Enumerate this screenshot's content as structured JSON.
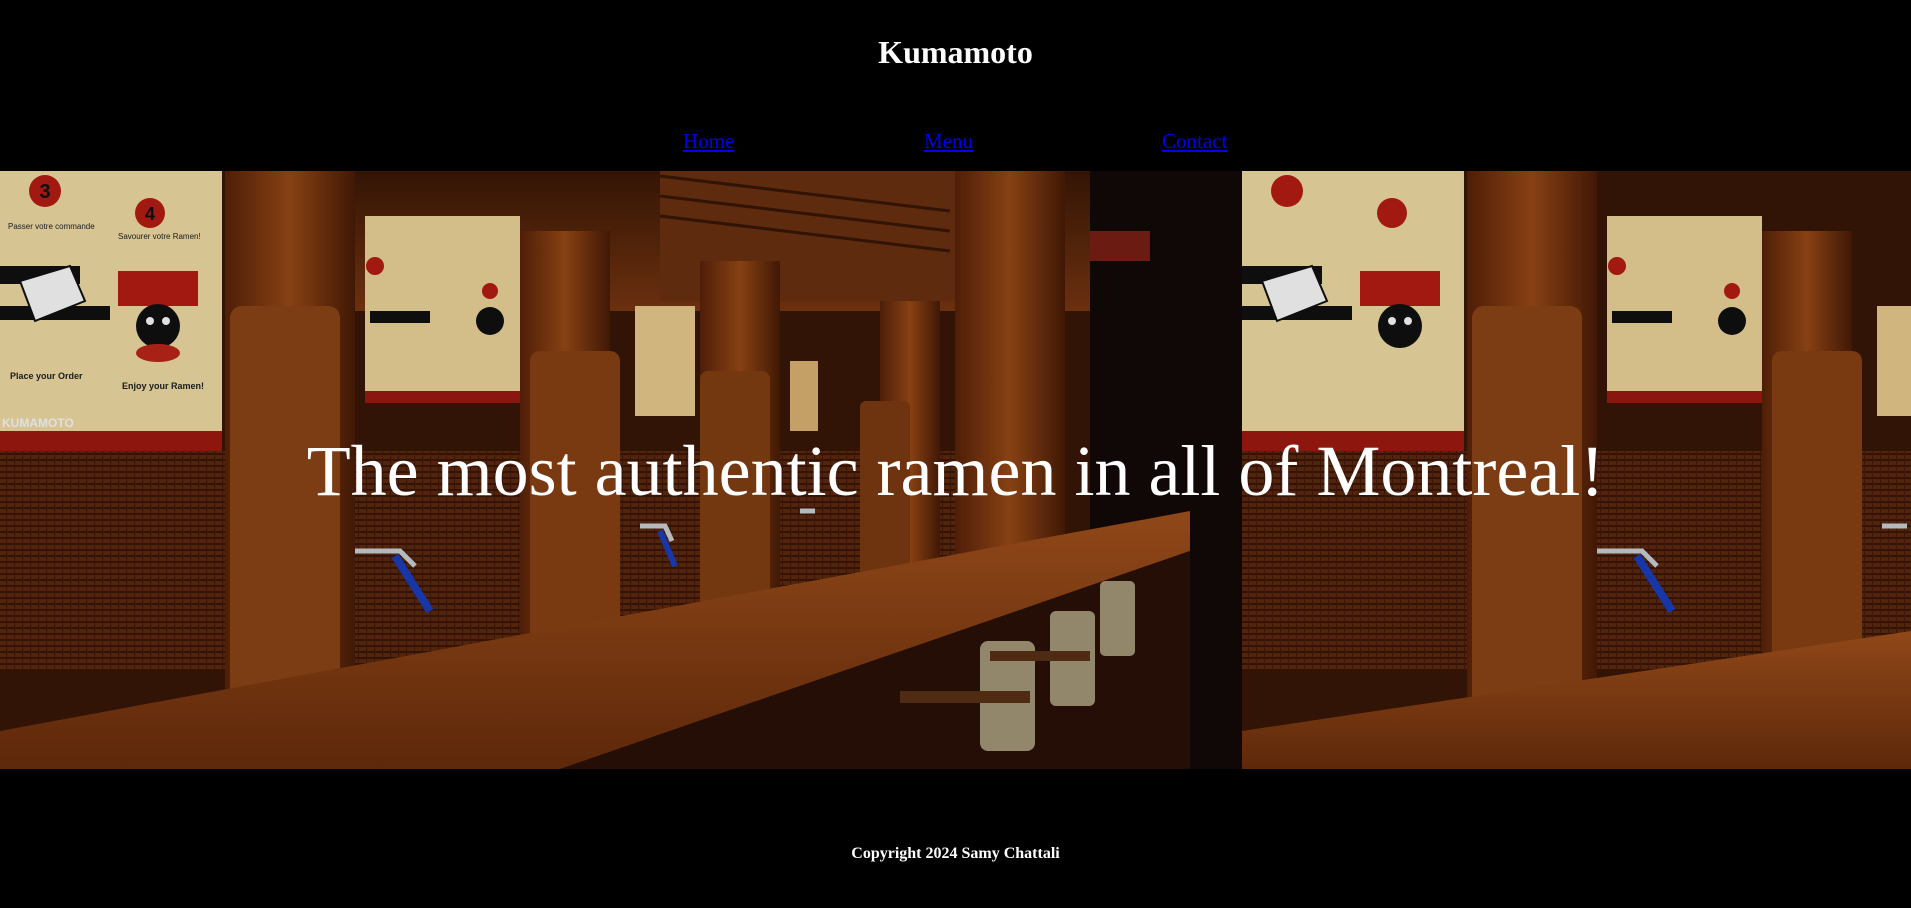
{
  "header": {
    "title": "Kumamoto"
  },
  "nav": {
    "items": [
      {
        "label": "Home"
      },
      {
        "label": "Menu"
      },
      {
        "label": "Contact"
      }
    ]
  },
  "hero": {
    "headline": "The most authentic ramen in all of Montreal!",
    "image": "restaurant-interior-photo",
    "sign": {
      "step3": "3",
      "step4": "4",
      "step3_fr": "Passer votre commande",
      "step4_fr": "Savourer votre Ramen!",
      "step3_en": "Place your Order",
      "step4_en": "Enjoy your Ramen!",
      "logo": "KUMAMOTO"
    }
  },
  "footer": {
    "copyright": "Copyright 2024 Samy Chattali"
  },
  "colors": {
    "background": "#000000",
    "link": "#0000ee",
    "text": "#ffffff",
    "wood": "#8a3f12"
  }
}
